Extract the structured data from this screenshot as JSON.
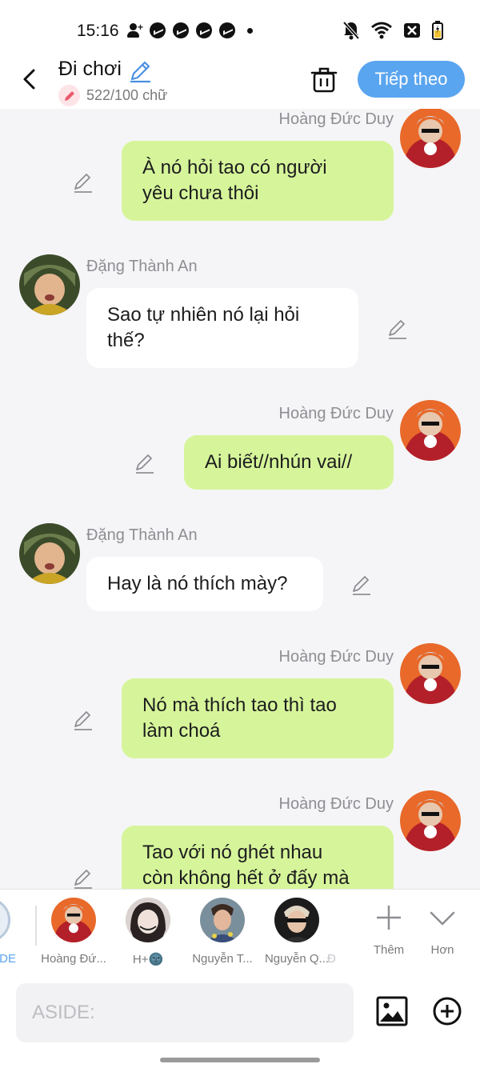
{
  "status_bar": {
    "time": "15:16",
    "left_icons": [
      "add-person-icon",
      "messenger-icon",
      "messenger-icon",
      "messenger-icon",
      "messenger-icon",
      "dot-icon"
    ],
    "right_icons": [
      "mute-icon",
      "wifi-icon",
      "no-sim-icon",
      "battery-icon"
    ]
  },
  "header": {
    "title": "Đi chơi",
    "char_count": "522/100 chữ",
    "next_label": "Tiếp theo"
  },
  "messages": [
    {
      "sender": "Hoàng Đức Duy",
      "side": "right",
      "text_lines": [
        "À nó hỏi tao có người",
        "yêu chưa thôi"
      ]
    },
    {
      "sender": "Đặng Thành An",
      "side": "left",
      "text_lines": [
        "Sao tự nhiên nó lại hỏi",
        "thế?"
      ]
    },
    {
      "sender": "Hoàng Đức Duy",
      "side": "right",
      "text_lines": [
        "Ai biết//nhún vai//"
      ]
    },
    {
      "sender": "Đặng Thành An",
      "side": "left",
      "text_lines": [
        "Hay là nó thích mày?"
      ]
    },
    {
      "sender": "Hoàng Đức Duy",
      "side": "right",
      "text_lines": [
        "Nó mà thích tao thì tao",
        "làm choá"
      ]
    },
    {
      "sender": "Hoàng Đức Duy",
      "side": "right",
      "text_lines": [
        "Tao với nó ghét nhau",
        "còn không hết ở đấy mà"
      ]
    }
  ],
  "characters": [
    {
      "label": "DE"
    },
    {
      "label": "Hoàng Đứ..."
    },
    {
      "label": "H+🌚"
    },
    {
      "label": "Nguyễn T..."
    },
    {
      "label": "Nguyễn Q..."
    },
    {
      "label": "Đ"
    }
  ],
  "tools": {
    "add_label": "Thêm",
    "more_label": "Hơn"
  },
  "input": {
    "placeholder": "ASIDE:"
  },
  "colors": {
    "accent": "#5aa5f0",
    "bubble_green": "#d6f59a",
    "bubble_white": "#ffffff",
    "background": "#f5f5f7"
  }
}
